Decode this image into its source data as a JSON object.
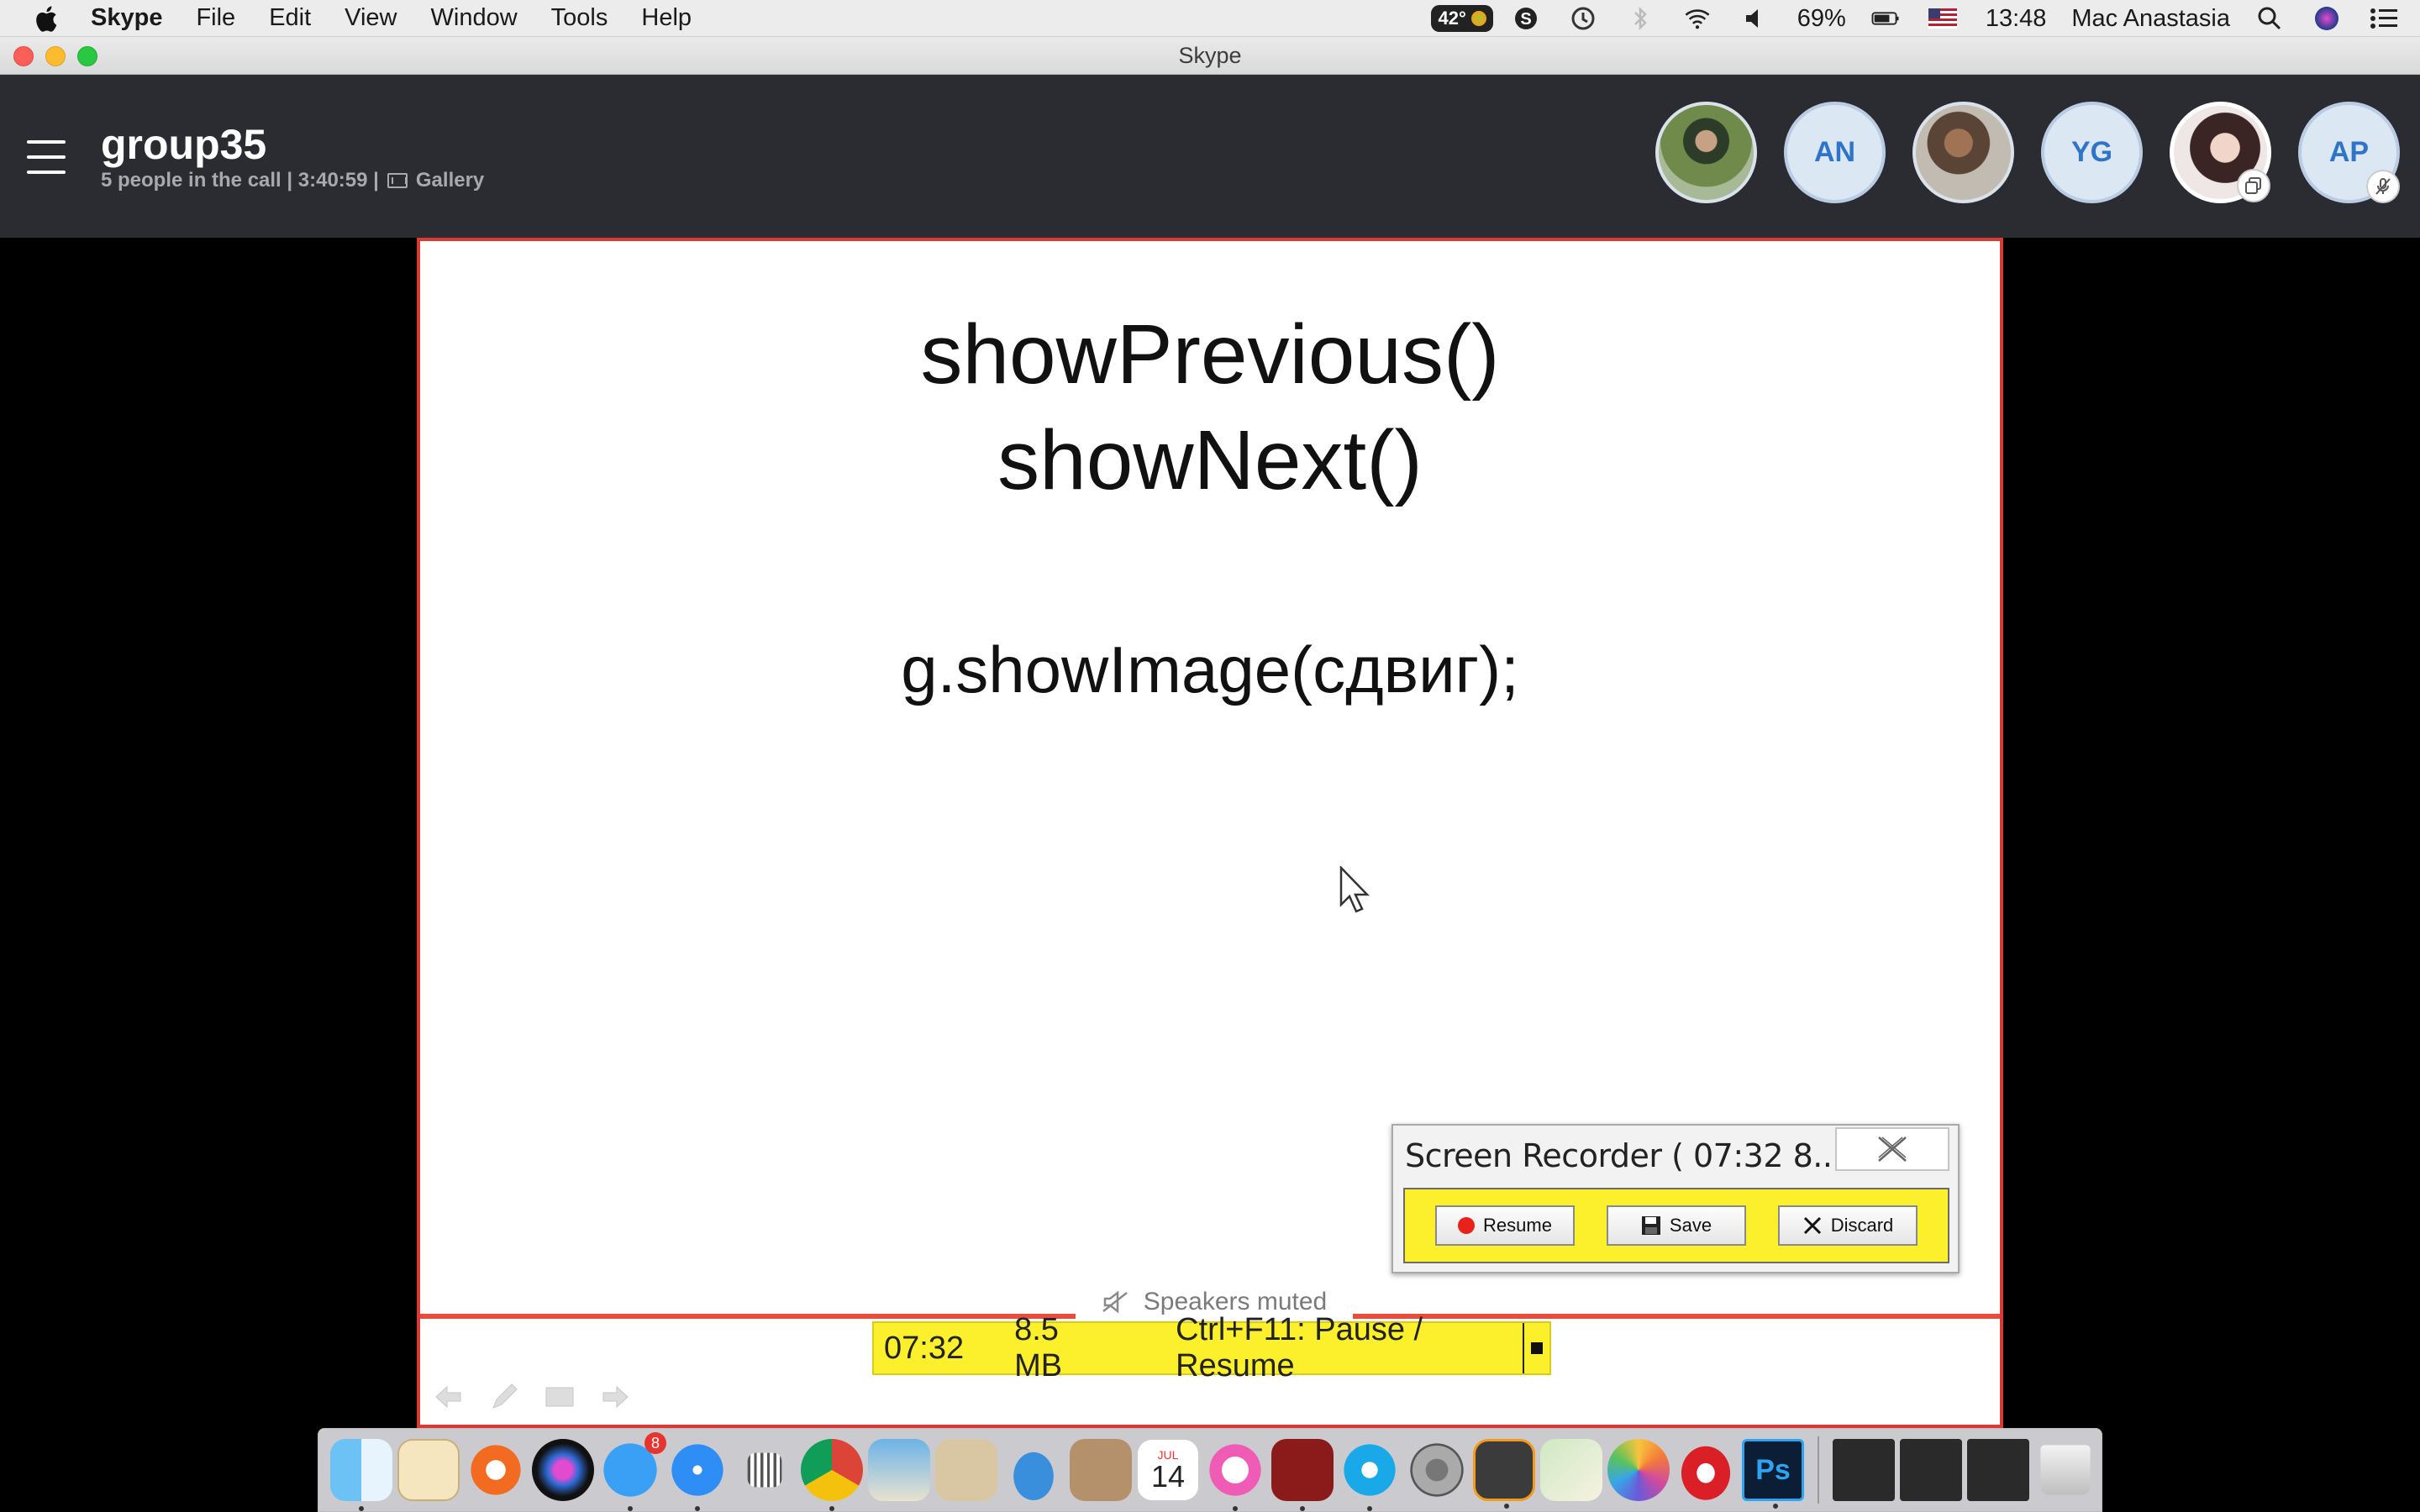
{
  "menubar": {
    "app_name": "Skype",
    "items": [
      "File",
      "Edit",
      "View",
      "Window",
      "Tools",
      "Help"
    ],
    "temperature": "42°",
    "battery": "69%",
    "clock": "13:48",
    "user": "Mac Anastasia"
  },
  "window": {
    "title": "Skype"
  },
  "call": {
    "group_name": "group35",
    "subtitle": "5 people in the call | 3:40:59  |",
    "view_mode": "Gallery",
    "participants": [
      {
        "kind": "photo"
      },
      {
        "initials": "AN"
      },
      {
        "kind": "photo"
      },
      {
        "initials": "YG"
      },
      {
        "kind": "photo",
        "self": true
      },
      {
        "initials": "AP",
        "muted": true
      }
    ]
  },
  "slide": {
    "line1": "showPrevious()",
    "line2": "showNext()",
    "line3": "g.showImage(сдвиг);"
  },
  "speakers": {
    "label": "Speakers muted"
  },
  "recording_status": {
    "time": "07:32",
    "size": "8.5 MB",
    "hotkey": "Ctrl+F11: Pause / Resume"
  },
  "recorder": {
    "title": "Screen Recorder ( 07:32   8....",
    "resume_label": "Resume",
    "save_label": "Save",
    "discard_label": "Discard"
  },
  "dock": {
    "app_store_badge": "8",
    "calendar_month": "JUL",
    "calendar_day": "14",
    "photoshop_label": "Ps"
  },
  "colors": {
    "share_border": "#d93a33",
    "recorder_yellow": "#fbf02b",
    "header_bg": "#2b2c31",
    "initials_text": "#2f74c7"
  }
}
